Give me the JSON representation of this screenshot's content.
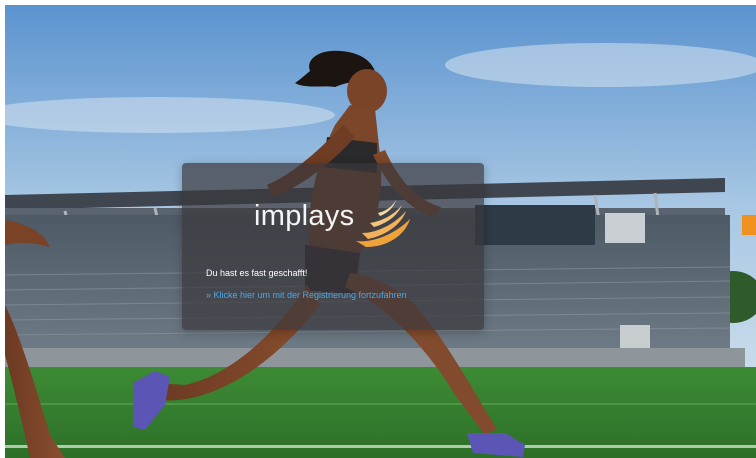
{
  "brand": {
    "name": "implays",
    "accent_color": "#f0a23a"
  },
  "login": {
    "message": "Du hast es fast geschafft!",
    "link_text": "» Klicke hier um mit der Registrierung fortzufahren"
  },
  "side_tab": {
    "color": "#f0901e"
  }
}
